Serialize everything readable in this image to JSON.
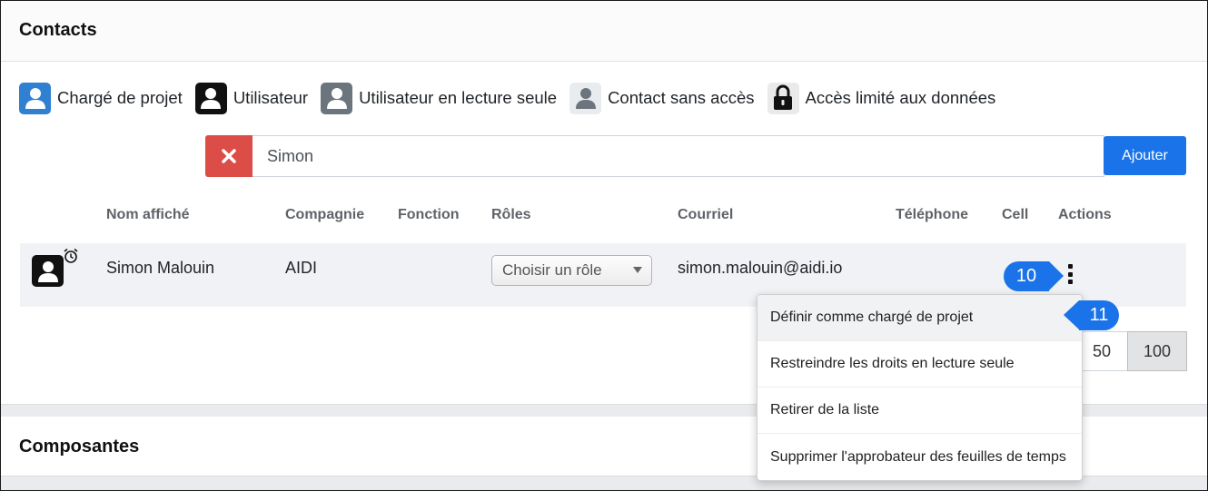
{
  "card": {
    "title": "Contacts"
  },
  "legend": [
    {
      "label": "Chargé de projet",
      "icon": "user-icon",
      "color": "#2f80d1"
    },
    {
      "label": "Utilisateur",
      "icon": "user-icon",
      "color": "#111111"
    },
    {
      "label": "Utilisateur en lecture seule",
      "icon": "user-icon",
      "color": "#6c757d"
    },
    {
      "label": "Contact sans accès",
      "icon": "user-icon",
      "color": "#e9ecef"
    },
    {
      "label": "Accès limité aux données",
      "icon": "lock-icon",
      "color": "#eaeaea"
    }
  ],
  "search": {
    "value": "Simon",
    "clear_icon": "close-icon",
    "add_label": "Ajouter"
  },
  "table": {
    "headers": [
      "Nom affiché",
      "Compagnie",
      "Fonction",
      "Rôles",
      "Courriel",
      "Téléphone",
      "Cell",
      "Actions"
    ],
    "rows": [
      {
        "name": "Simon Malouin",
        "company": "AIDI",
        "function": "",
        "role_select": "Choisir un rôle",
        "email": "simon.malouin@aidi.io",
        "phone": "",
        "cell": ""
      }
    ]
  },
  "pagination": {
    "options": [
      "50",
      "100"
    ],
    "selected": "100"
  },
  "actions_menu": {
    "items": [
      "Définir comme chargé de projet",
      "Restreindre les droits en lecture seule",
      "Retirer de la liste",
      "Supprimer l'approbateur des feuilles de temps"
    ]
  },
  "callouts": {
    "step_10": "10",
    "step_11": "11"
  },
  "section2": {
    "title": "Composantes"
  },
  "colors": {
    "accent": "#1a73e8",
    "danger": "#dc4d47"
  }
}
